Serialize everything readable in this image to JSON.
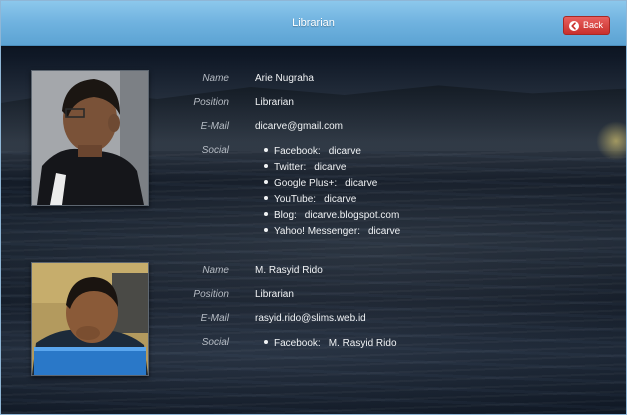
{
  "header": {
    "title": "Librarian",
    "back_label": "Back"
  },
  "labels": {
    "name": "Name",
    "position": "Position",
    "email": "E-Mail",
    "social": "Social"
  },
  "members": [
    {
      "name": "Arie Nugraha",
      "position": "Librarian",
      "email": "dicarve@gmail.com",
      "social": [
        {
          "service": "Facebook:",
          "handle": "dicarve"
        },
        {
          "service": "Twitter:",
          "handle": "dicarve"
        },
        {
          "service": "Google Plus+:",
          "handle": "dicarve"
        },
        {
          "service": "YouTube:",
          "handle": "dicarve"
        },
        {
          "service": "Blog:",
          "handle": "dicarve.blogspot.com"
        },
        {
          "service": "Yahoo! Messenger:",
          "handle": "dicarve"
        }
      ]
    },
    {
      "name": "M. Rasyid Rido",
      "position": "Librarian",
      "email": "rasyid.rido@slims.web.id",
      "social": [
        {
          "service": "Facebook:",
          "handle": "M. Rasyid Rido"
        }
      ]
    }
  ],
  "colors": {
    "header": "#6fb2df",
    "back_button": "#d9534f"
  },
  "icons": {
    "back": "circle-arrow-left-icon"
  }
}
